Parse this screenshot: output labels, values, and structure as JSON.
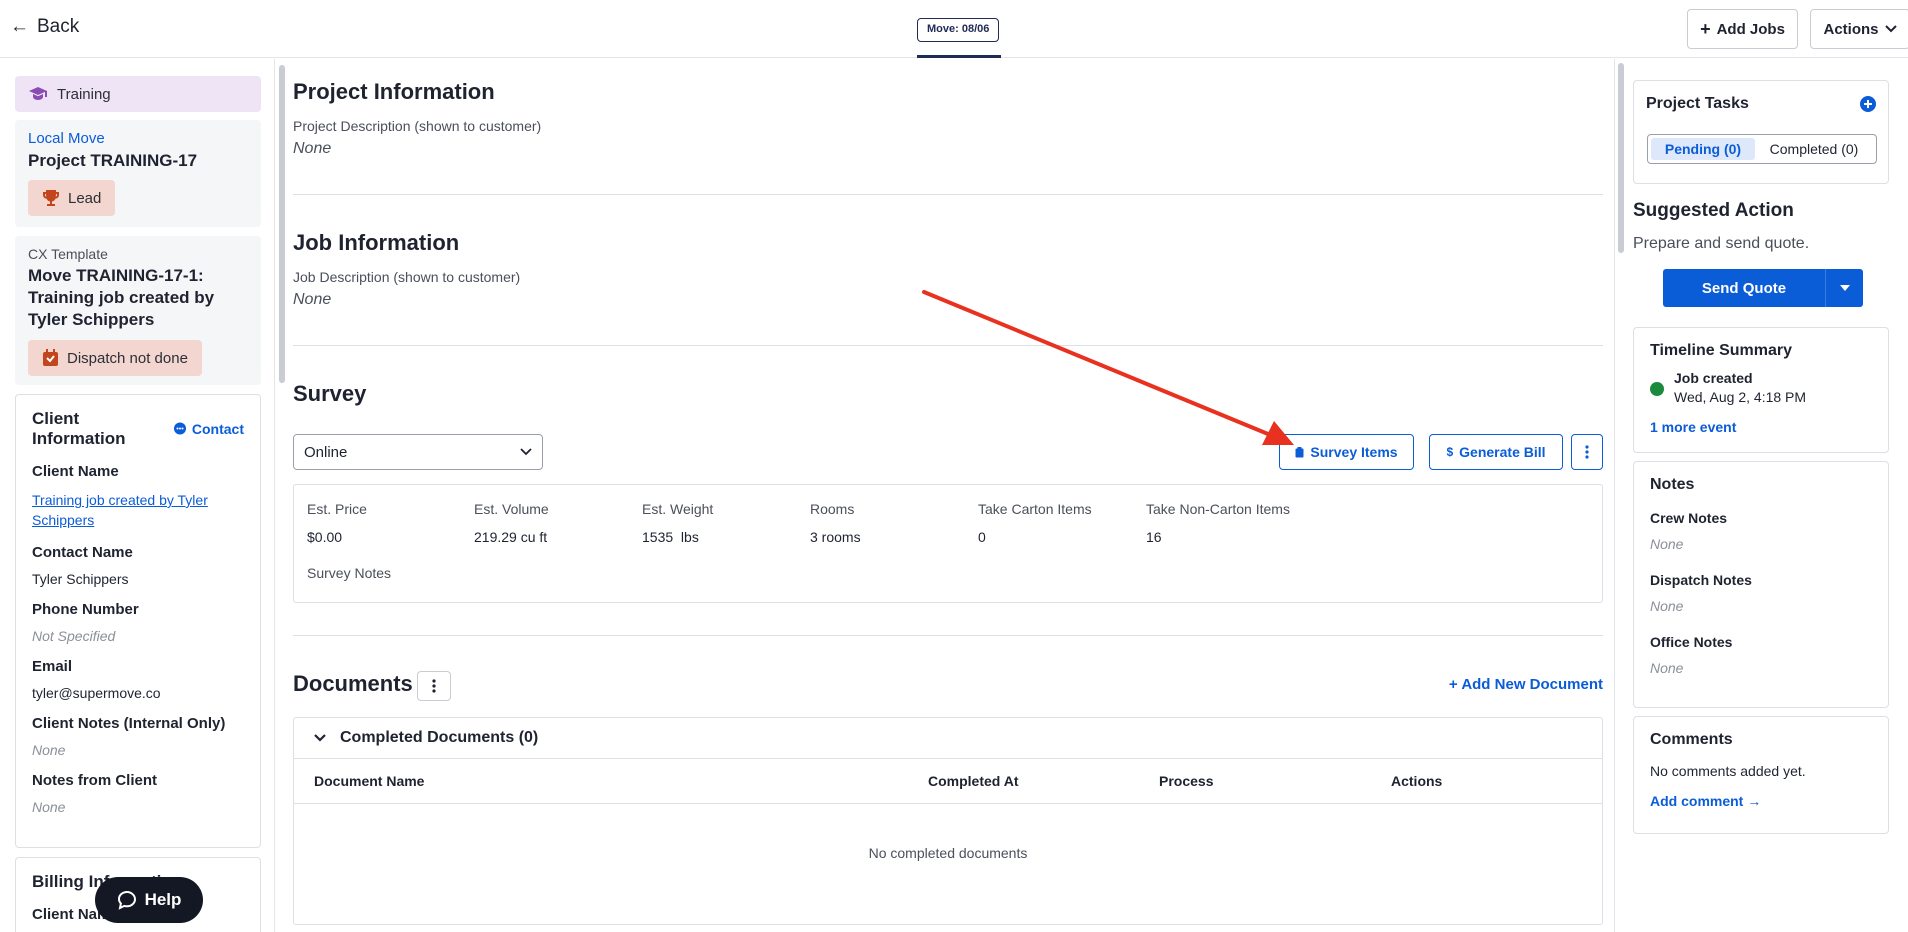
{
  "header": {
    "back_label": "Back",
    "move_tab": "Move: 08/06",
    "add_jobs_label": "Add Jobs",
    "actions_label": "Actions"
  },
  "left": {
    "training_label": "Training",
    "project_type": "Local Move",
    "project_name": "Project TRAINING-17",
    "project_status": "Lead",
    "template_label": "CX Template",
    "job_title": "Move TRAINING-17-1: Training job created by Tyler Schippers",
    "dispatch_status": "Dispatch not done",
    "client_info_title": "Client Information",
    "contact_link": "Contact",
    "client_name_label": "Client Name",
    "client_name_value": "Training job created by Tyler Schippers",
    "contact_name_label": "Contact Name",
    "contact_name_value": "Tyler Schippers",
    "phone_label": "Phone Number",
    "phone_value": "Not Specified",
    "email_label": "Email",
    "email_value": "tyler@supermove.co",
    "client_notes_label": "Client Notes (Internal Only)",
    "client_notes_value": "None",
    "notes_from_client_label": "Notes from Client",
    "notes_from_client_value": "None",
    "billing_title": "Billing Information",
    "billing_client_name_label": "Client Name",
    "help_label": "Help"
  },
  "main": {
    "project_info_title": "Project Information",
    "project_desc_label": "Project Description (shown to customer)",
    "project_desc_value": "None",
    "job_info_title": "Job Information",
    "job_desc_label": "Job Description (shown to customer)",
    "job_desc_value": "None",
    "survey_title": "Survey",
    "survey_method": "Online",
    "survey_items_label": "Survey Items",
    "generate_bill_label": "Generate Bill",
    "stats": [
      {
        "label": "Est. Price",
        "value": "$0.00"
      },
      {
        "label": "Est. Volume",
        "value": "219.29 cu ft"
      },
      {
        "label": "Est. Weight",
        "value": "1535  lbs"
      },
      {
        "label": "Rooms",
        "value": "3 rooms"
      },
      {
        "label": "Take Carton Items",
        "value": "0"
      },
      {
        "label": "Take Non-Carton Items",
        "value": "16"
      }
    ],
    "survey_notes_label": "Survey Notes",
    "documents_title": "Documents",
    "add_document_label": "Add New Document",
    "completed_docs_label": "Completed Documents (0)",
    "doc_columns": [
      "Document Name",
      "Completed At",
      "Process",
      "Actions"
    ],
    "no_docs_text": "No completed documents"
  },
  "right": {
    "tasks_title": "Project Tasks",
    "tab_pending": "Pending (0)",
    "tab_completed": "Completed (0)",
    "suggested_title": "Suggested Action",
    "suggested_text": "Prepare and send quote.",
    "send_quote_label": "Send Quote",
    "timeline_title": "Timeline Summary",
    "timeline_event": "Job created",
    "timeline_time": "Wed, Aug 2, 4:18 PM",
    "more_events": "1 more event",
    "notes_title": "Notes",
    "crew_notes_label": "Crew Notes",
    "crew_notes_value": "None",
    "dispatch_notes_label": "Dispatch Notes",
    "dispatch_notes_value": "None",
    "office_notes_label": "Office Notes",
    "office_notes_value": "None",
    "comments_title": "Comments",
    "comments_empty": "No comments added yet.",
    "add_comment_label": "Add comment →"
  },
  "colors": {
    "accent": "#0b5cd7",
    "training_bg": "#efe4f5",
    "status_pill_bg": "#f2d6cf",
    "annotation_arrow": "#e8321f",
    "timeline_dot": "#1b8a3c"
  }
}
